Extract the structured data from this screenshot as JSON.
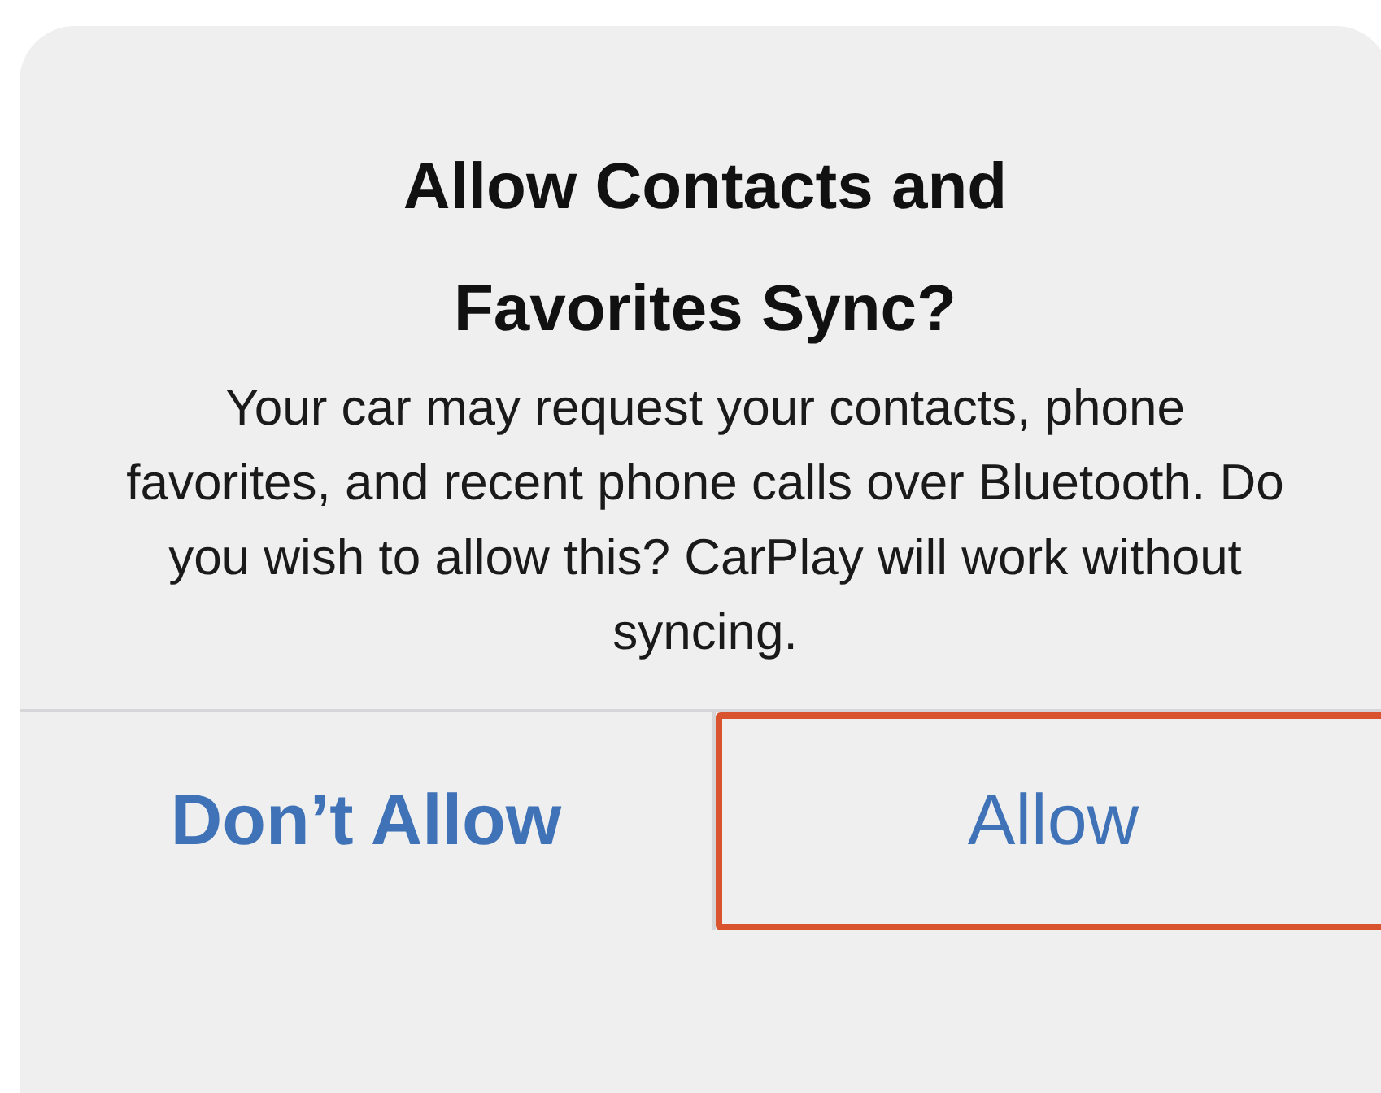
{
  "alert": {
    "title": "Allow Contacts and Favorites Sync?",
    "message": "Your car may request your contacts, phone favorites, and recent phone calls over Bluetooth. Do you wish to allow this? CarPlay will work without syncing.",
    "buttons": [
      {
        "label": "Don’t Allow",
        "kind": "preferred",
        "highlighted": false
      },
      {
        "label": "Allow",
        "kind": "normal",
        "highlighted": true
      }
    ]
  }
}
